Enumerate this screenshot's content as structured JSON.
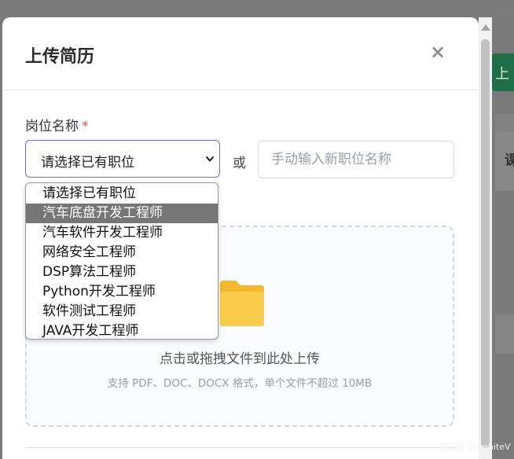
{
  "background": {
    "right_button_label": "上",
    "right_panel_label": "课"
  },
  "modal": {
    "title": "上传简历",
    "close_glyph": "×",
    "position_field": {
      "label": "岗位名称",
      "required_marker": "*",
      "selected_value": "请选择已有职位",
      "options": [
        "请选择已有职位",
        "汽车底盘开发工程师",
        "汽车软件开发工程师",
        "网络安全工程师",
        "DSP算法工程师",
        "Python开发工程师",
        "软件测试工程师",
        "JAVA开发工程师"
      ],
      "highlighted_option": "汽车底盘开发工程师"
    },
    "or_text": "或",
    "manual_input": {
      "placeholder": "手动输入新职位名称",
      "value": ""
    },
    "upload": {
      "main_text": "点击或拖拽文件到此处上传",
      "hint_text": "支持 PDF、DOC、DOCX 格式，单个文件不超过 10MB",
      "icon": "folder-icon"
    }
  },
  "watermark": "CSDN @AwhiteV",
  "colors": {
    "select_border": "#6a6ef0",
    "required": "#e24b4b",
    "folder": "#f7c948",
    "highlight": "#767676",
    "overlay": "#7a7a7a"
  }
}
